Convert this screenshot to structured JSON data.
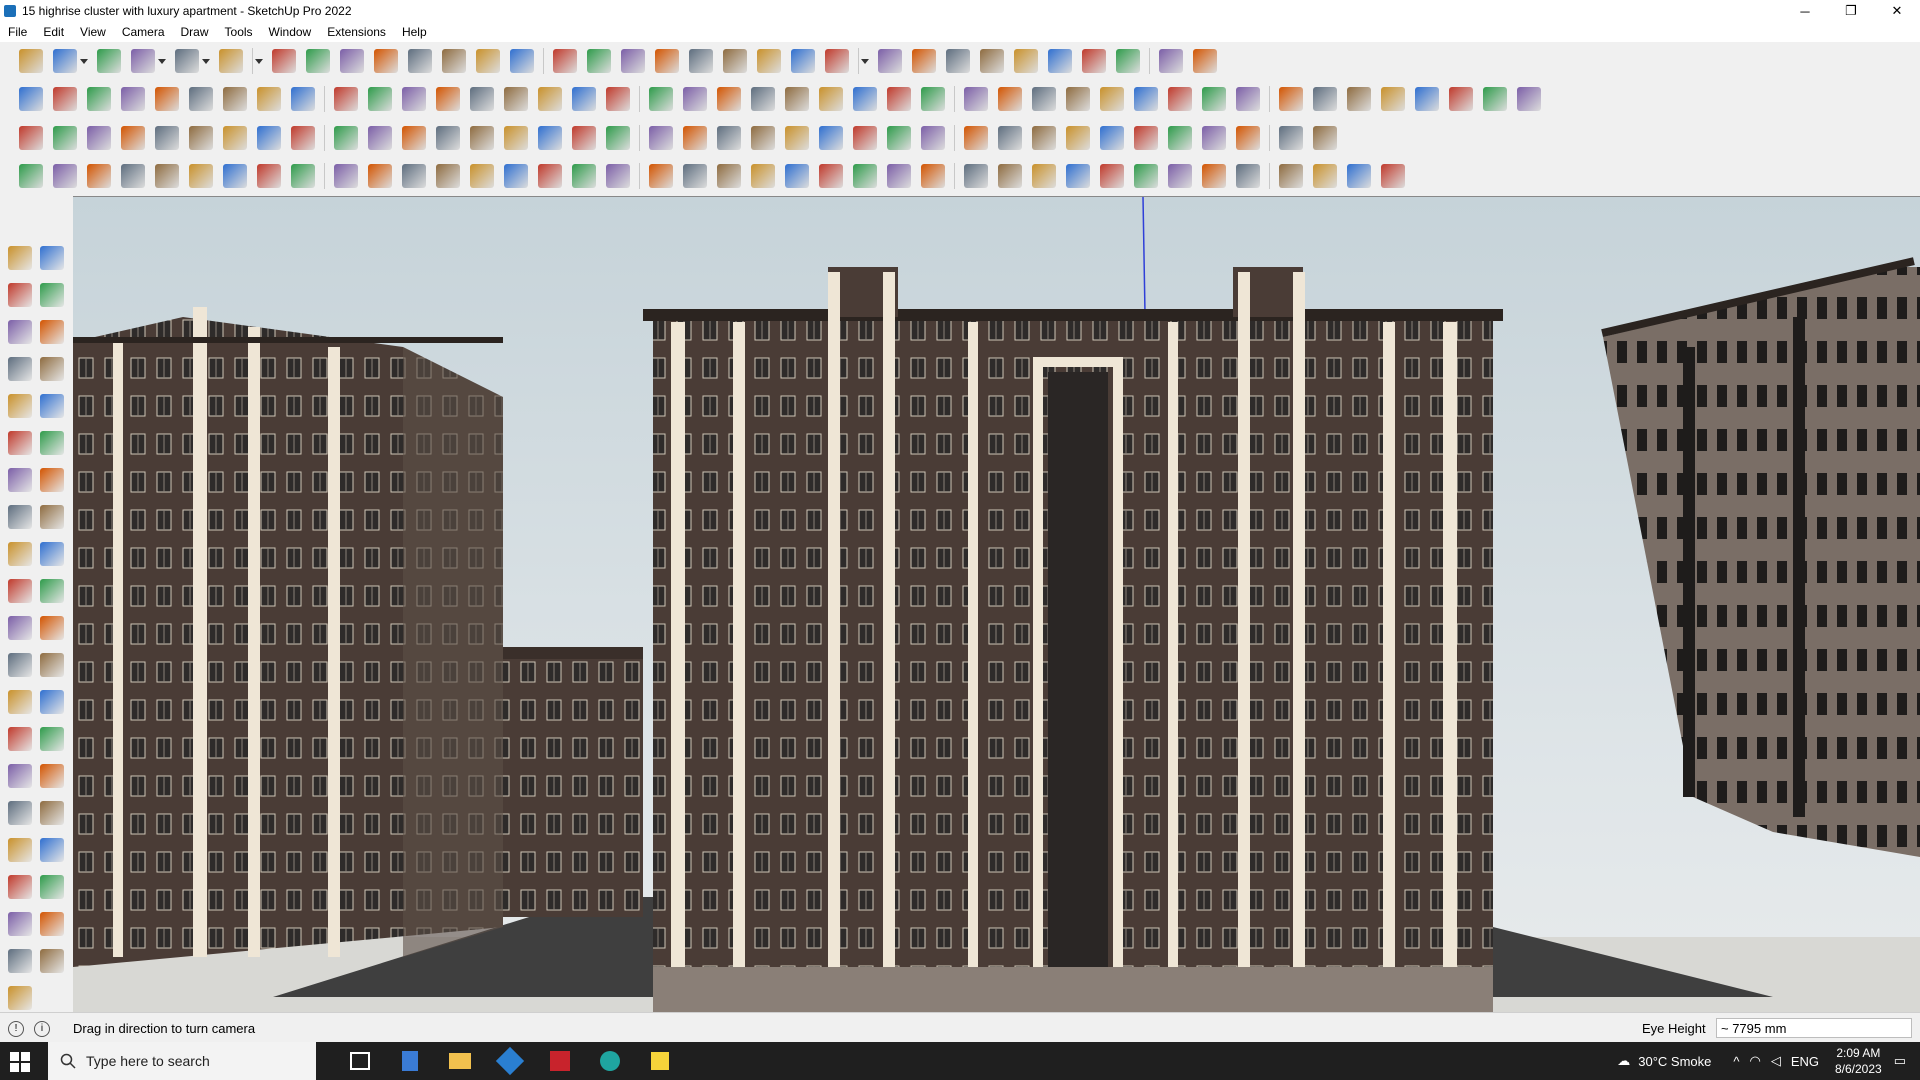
{
  "window": {
    "title": "15 highrise cluster with luxury apartment - SketchUp Pro 2022",
    "controls": {
      "minimize": "─",
      "restore": "❐",
      "close": "✕"
    }
  },
  "menu": [
    "File",
    "Edit",
    "View",
    "Camera",
    "Draw",
    "Tools",
    "Window",
    "Extensions",
    "Help"
  ],
  "colors": {
    "sky": "#c6d3d9",
    "facade_dark": "#4a3c36",
    "facade_light": "#efe6d6",
    "window": "#2e2b2a",
    "taskbar": "#1f1f1f"
  },
  "toolbars": {
    "row1_icons": [
      "zoom-icon",
      "select-icon",
      "dropdown-icon",
      "eraser-icon",
      "pencil-icon",
      "dropdown-icon",
      "arc-icon",
      "dropdown-icon",
      "rectangle-icon",
      "dropdown-icon",
      "push-pull-icon",
      "follow-me-icon",
      "move-icon",
      "rotate-icon",
      "scale-icon",
      "tape-measure-icon",
      "text-icon",
      "paint-bucket-icon",
      "orbit-icon",
      "pan-icon",
      "zoom-tool-icon",
      "zoom-extents-icon",
      "section-plane-icon",
      "section-display-icon",
      "section-fill-icon",
      "section-cut-icon",
      "account-icon",
      "dropdown-icon",
      "component-icon",
      "warehouse-icon",
      "extension-icon",
      "sandbox-icon",
      "sandbox-2-icon",
      "axes-icon",
      "position-camera-icon",
      "undo-icon",
      "redo-icon",
      "extension-manager-icon"
    ],
    "row2_icons": [
      "iso-view-icon",
      "top-view-icon",
      "front-view-icon",
      "push-icon",
      "solid-union-icon",
      "solid-subtract-icon",
      "solid-trim-icon",
      "solid-intersect-icon",
      "solid-split-icon",
      "solid-outer-icon",
      "sandbox-smoove-icon",
      "xray-icon",
      "back-edges-icon",
      "wireframe-icon",
      "hidden-line-icon",
      "shaded-icon",
      "textured-icon",
      "monochrome-icon",
      "house-icon",
      "house-2-icon",
      "house-3-icon",
      "house-4-icon",
      "style-icon",
      "font-icon",
      "tag-icon",
      "ruler-icon",
      "circle-icon",
      "circle-2-icon",
      "polygon-icon",
      "ellipse-icon",
      "parallelogram-icon",
      "arc-2-icon",
      "rotate-2-icon",
      "curve-icon",
      "loop-icon",
      "scale-2-icon",
      "eraser-2-icon",
      "surface-icon",
      "grid-icon",
      "extrude-icon",
      "extrude-2-icon",
      "sphere-icon",
      "cube-icon",
      "plane-icon"
    ],
    "row3_icons": [
      "cube-blue-icon",
      "diamond-blue-icon",
      "diamond-yellow-icon",
      "diamond-green-icon",
      "diamond-red-icon",
      "plate-icon",
      "arc-orange-icon",
      "square-red-icon",
      "list-icon",
      "flag-icon",
      "box-icon",
      "link-icon",
      "bracket-icon",
      "nodes-icon",
      "cross-red-icon",
      "cross-green-icon",
      "cross-blue-icon",
      "cone-icon",
      "flask-icon",
      "warning-icon",
      "hook-icon",
      "split-icon",
      "circle-arrow-icon",
      "star-icon",
      "undo-red-icon",
      "plugin-1-icon",
      "plugin-2-icon",
      "plugin-3-icon",
      "plugin-4-icon",
      "plugin-5-icon",
      "plugin-6-icon",
      "window-icon",
      "grid-orange-icon",
      "grid-orange-2-icon",
      "grid-orange-3-icon",
      "dots-red-icon",
      "curve-dots-icon",
      "array-icon"
    ],
    "row4_icons": [
      "line-tool-icon",
      "dashed-curve-icon",
      "car-icon",
      "scissors-icon",
      "gear-icon",
      "cloud-icon",
      "hand-icon",
      "sphere-2-icon",
      "sphere-3-icon",
      "arrow-icon",
      "corner-icon",
      "corner-2-icon",
      "line-red-icon",
      "spline-icon",
      "stair-icon",
      "pen-icon",
      "column-icon",
      "fence-icon",
      "hand-2-icon",
      "leaf-icon",
      "arrow-left-icon",
      "stack-icon",
      "slash-icon",
      "bolt-icon",
      "bolt-2-icon",
      "bolt-3-icon",
      "stairs-icon",
      "bars-icon",
      "door-icon",
      "arch-icon",
      "rails-icon",
      "grille-icon",
      "grille-2-icon",
      "grille-3-icon",
      "pillars-icon",
      "ring-icon",
      "ring-2-icon",
      "ramp-icon",
      "ramp-2-icon",
      "tag-2-icon"
    ]
  },
  "left_tools": [
    "select-icon",
    "orbit-icon",
    "paint-icon",
    "eraser-icon",
    "component-icon",
    "tape-icon",
    "pencil-icon",
    "freehand-icon",
    "rectangle-icon",
    "rotated-rect-icon",
    "circle-icon",
    "polygon-icon",
    "arc-icon",
    "two-point-arc-icon",
    "pie-icon",
    "three-point-arc-icon",
    "move-icon",
    "push-pull-icon",
    "rotate-icon",
    "follow-me-icon",
    "scale-icon",
    "offset-icon",
    "tape-measure-icon",
    "dimension-icon",
    "protractor-icon",
    "text-icon",
    "axes-icon",
    "3d-text-icon",
    "orbit-2-icon",
    "pan-icon",
    "zoom-icon",
    "zoom-window-icon",
    "zoom-extents-icon",
    "zoom-previous-icon",
    "position-camera-icon",
    "look-around-icon",
    "walk-icon",
    "section-plane-icon",
    "section-display-icon",
    "section-cut-icon",
    "section-fill-icon"
  ],
  "status": {
    "hint": "Drag in direction to turn camera",
    "eye_height_label": "Eye Height",
    "eye_height_value": "~ 7795 mm"
  },
  "taskbar": {
    "search_placeholder": "Type here to search",
    "weather": "30°C  Smoke",
    "language": "ENG",
    "time": "2:09 AM",
    "date": "8/6/2023"
  }
}
